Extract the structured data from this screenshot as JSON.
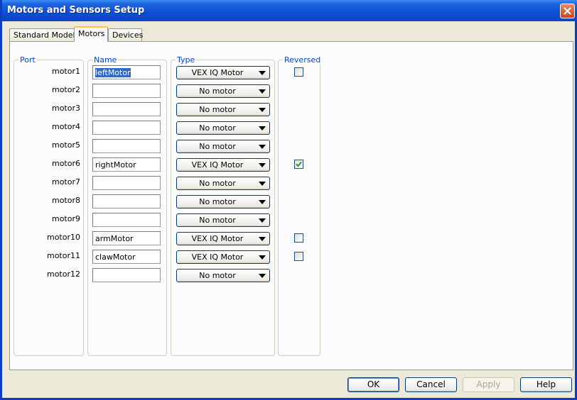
{
  "window": {
    "title": "Motors and Sensors Setup"
  },
  "tabs": [
    {
      "label": "Standard Models",
      "active": false
    },
    {
      "label": "Motors",
      "active": true
    },
    {
      "label": "Devices",
      "active": false
    }
  ],
  "columns": {
    "port": "Port",
    "name": "Name",
    "type": "Type",
    "reversed": "Reversed"
  },
  "motors": [
    {
      "port": "motor1",
      "name": "leftMotor",
      "type": "VEX IQ Motor",
      "reversed": false,
      "show_reversed": true
    },
    {
      "port": "motor2",
      "name": "",
      "type": "No motor",
      "show_reversed": false
    },
    {
      "port": "motor3",
      "name": "",
      "type": "No motor",
      "show_reversed": false
    },
    {
      "port": "motor4",
      "name": "",
      "type": "No motor",
      "show_reversed": false
    },
    {
      "port": "motor5",
      "name": "",
      "type": "No motor",
      "show_reversed": false
    },
    {
      "port": "motor6",
      "name": "rightMotor",
      "type": "VEX IQ Motor",
      "reversed": true,
      "show_reversed": true
    },
    {
      "port": "motor7",
      "name": "",
      "type": "No motor",
      "show_reversed": false
    },
    {
      "port": "motor8",
      "name": "",
      "type": "No motor",
      "show_reversed": false
    },
    {
      "port": "motor9",
      "name": "",
      "type": "No motor",
      "show_reversed": false
    },
    {
      "port": "motor10",
      "name": "armMotor",
      "type": "VEX IQ Motor",
      "reversed": false,
      "show_reversed": true
    },
    {
      "port": "motor11",
      "name": "clawMotor",
      "type": "VEX IQ Motor",
      "reversed": false,
      "show_reversed": true
    },
    {
      "port": "motor12",
      "name": "",
      "type": "No motor",
      "show_reversed": false
    }
  ],
  "buttons": {
    "ok": "OK",
    "cancel": "Cancel",
    "apply": "Apply",
    "help": "Help"
  },
  "colors": {
    "group_label": "#0046d5",
    "check": "#21a121",
    "selection": "#316ac5"
  }
}
